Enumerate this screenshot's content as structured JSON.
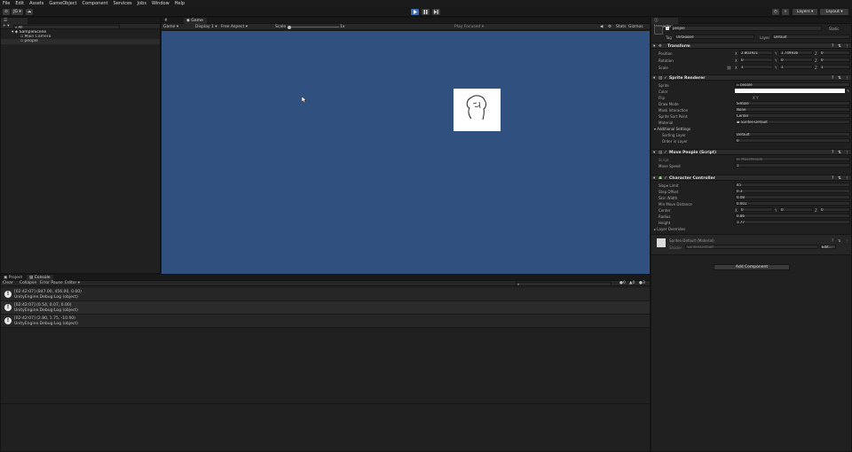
{
  "menu": [
    "File",
    "Edit",
    "Assets",
    "GameObject",
    "Component",
    "Services",
    "Jobs",
    "Window",
    "Help"
  ],
  "toolbar": {
    "account": "⊙",
    "cloud": "☁",
    "collab": "JG ▾",
    "layers": "Layers",
    "layout": "Layout"
  },
  "hierarchy": {
    "tab": "Hierarchy",
    "add": "+ ▾",
    "search_placeholder": "All",
    "scene": "SampleScene",
    "items": [
      "Main Camera",
      "people"
    ]
  },
  "scene_tabs": {
    "scene": "Scene",
    "game": "Game"
  },
  "game_bar": {
    "mode": "Game",
    "display": "Display 1",
    "aspect": "Free Aspect",
    "scale_label": "Scale",
    "scale_value": "1x",
    "play_focused": "Play Focused",
    "stats": "Stats",
    "gizmos": "Gizmos"
  },
  "bottom": {
    "tabs": [
      "Project",
      "Console"
    ],
    "console_buttons": [
      "Clear",
      "Collapse",
      "Error Pause",
      "Editor ▾"
    ],
    "counts": [
      "0",
      "0",
      "3"
    ],
    "logs": [
      {
        "line1": "[02:42:07] (847.00, 456.00, 0.00)",
        "line2": "UnityEngine.Debug:Log (object)"
      },
      {
        "line1": "[02:42:07] (0.54, 0.07, 0.00)",
        "line2": "UnityEngine.Debug:Log (object)"
      },
      {
        "line1": "[02:42:07] (2.80, 1.75, -10.00)",
        "line2": "UnityEngine.Debug:Log (object)"
      }
    ]
  },
  "inspector": {
    "tab": "Inspector",
    "object_name": "people",
    "static": "Static",
    "tag_label": "Tag",
    "tag": "Untagged",
    "layer_label": "Layer",
    "layer": "Default",
    "transform": {
      "title": "Transform",
      "position_label": "Position",
      "px": "2.803921",
      "py": "1.749936",
      "pz": "0",
      "rotation_label": "Rotation",
      "rx": "0",
      "ry": "0",
      "rz": "0",
      "scale_label": "Scale",
      "sx": "1",
      "sy": "1",
      "sz": "1"
    },
    "sprite": {
      "title": "Sprite Renderer",
      "labels": [
        "Sprite",
        "Color",
        "Flip",
        "Draw Mode",
        "Mask Interaction",
        "Sprite Sort Point",
        "Material"
      ],
      "sprite": "people",
      "flip": "X   Y",
      "draw_mode": "Simple",
      "mask": "None",
      "sort_point": "Center",
      "material": "Sprites-Default",
      "additional": "Additional Settings",
      "sorting_layer_label": "Sorting Layer",
      "sorting_layer": "Default",
      "order_label": "Order in Layer",
      "order": "0"
    },
    "script": {
      "title": "Move People (Script)",
      "script_label": "Script",
      "script": "MovePeople",
      "speed_label": "Move Speed",
      "speed": "1"
    },
    "cc": {
      "title": "Character Controller",
      "labels": [
        "Slope Limit",
        "Step Offset",
        "Skin Width",
        "Min Move Distance",
        "Center",
        "Radius",
        "Height",
        "Layer Overrides"
      ],
      "slope": "45",
      "step": "0.3",
      "skin": "0.08",
      "minmove": "0.001",
      "cx": "0",
      "cy": "0",
      "cz": "0",
      "radius": "0.86",
      "height": "1.77"
    },
    "material": {
      "name": "Sprites-Default (Material)",
      "shader_label": "Shader",
      "shader": "Sprites/Default",
      "edit": "Edit..."
    },
    "add_component": "Add Component"
  },
  "colors": {
    "game_bg": "#30507f",
    "accent": "#3d75c2",
    "play_active": "#3e6db4"
  }
}
